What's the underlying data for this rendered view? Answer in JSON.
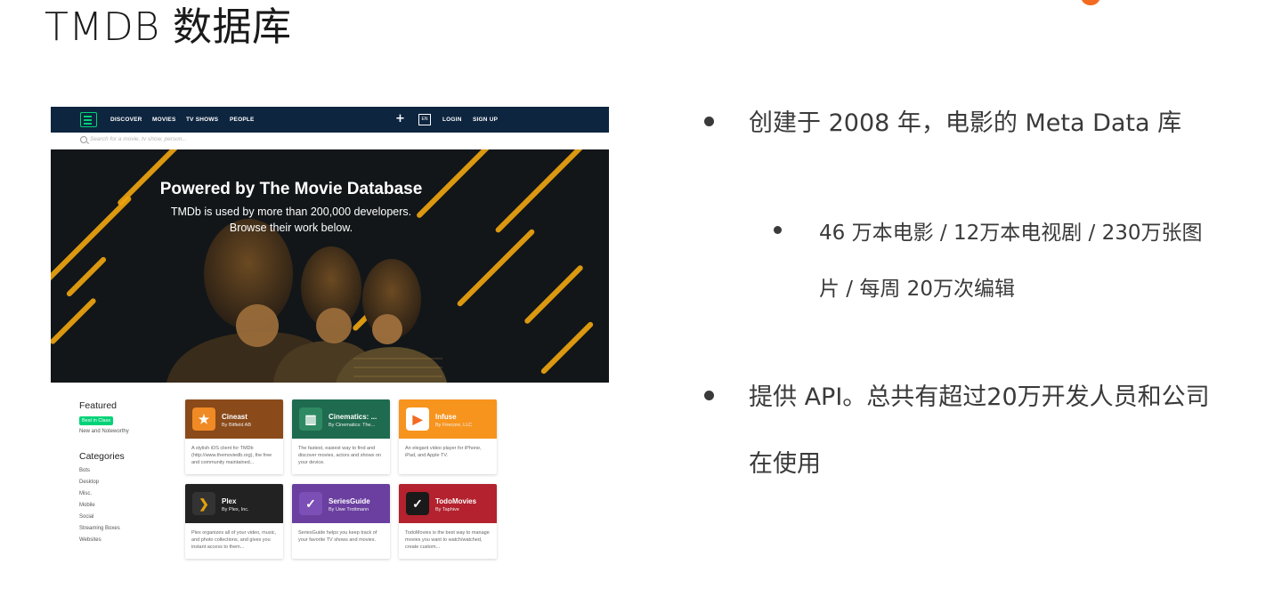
{
  "slide": {
    "title": "TMDB 数据库"
  },
  "screenshot": {
    "nav": {
      "items": [
        "DISCOVER",
        "MOVIES",
        "TV SHOWS",
        "PEOPLE"
      ],
      "plus": "+",
      "lang": "EN",
      "login": "LOGIN",
      "signup": "SIGN UP"
    },
    "search": {
      "placeholder": "Search for a movie, tv show, person..."
    },
    "hero": {
      "title": "Powered by The Movie Database",
      "line1": "TMDb is used by more than 200,000 developers.",
      "line2": "Browse their work below."
    },
    "sidebar": {
      "featured_heading": "Featured",
      "featured_badge": "Best in Class",
      "featured_link": "New and Noteworthy",
      "categories_heading": "Categories",
      "categories": [
        "Bots",
        "Desktop",
        "Misc.",
        "Mobile",
        "Social",
        "Streaming Boxes",
        "Websites"
      ]
    },
    "apps": [
      {
        "name": "Cineast",
        "by": "By Bitfield AB",
        "desc": "A stylish iOS client for TMDb (http://www.themoviedb.org), the free and community maintained...",
        "color": "#e8791d",
        "icon": "star-film-icon"
      },
      {
        "name": "Cinematics: ...",
        "by": "By Cinematics: The...",
        "desc": "The fastest, easiest way to find and discover movies, actors and shows on your device.",
        "color": "#1f6b4f",
        "icon": "film-strip-icon"
      },
      {
        "name": "Infuse",
        "by": "By Firecore, LLC",
        "desc": "An elegant video player for iPhone, iPad, and Apple TV.",
        "color": "#f7941d",
        "icon": "play-icon"
      },
      {
        "name": "Plex",
        "by": "By Plex, Inc.",
        "desc": "Plex organizes all of your video, music, and photo collections, and gives you instant access to them...",
        "color": "#222222",
        "icon": "chevron-right-icon"
      },
      {
        "name": "SeriesGuide",
        "by": "By Uwe Trottmann",
        "desc": "SeriesGuide helps you keep track of your favorite TV shows and movies.",
        "color": "#6a3fa0",
        "icon": "check-icon"
      },
      {
        "name": "TodoMovies",
        "by": "By Taphive",
        "desc": "TodoMovies is the best way to manage movies you want to watch/watched, create custom...",
        "color": "#b3222e",
        "icon": "check-icon"
      }
    ]
  },
  "bullets": [
    {
      "text": "创建于 2008 年，电影的 Meta Data 库",
      "level": 1
    },
    {
      "line1": "46 万本电影 / 12万本电视剧 / 230万张图",
      "line2": "片 / 每周 20万次编辑",
      "level": 2
    },
    {
      "line1": "提供 API。总共有超过20万开发人员和公司",
      "line2": "在使用",
      "level": 1
    }
  ],
  "colors": {
    "navy": "#0d253f",
    "green": "#01d277",
    "accent_orange": "#f26b21",
    "stripe": "#f2a60f"
  }
}
